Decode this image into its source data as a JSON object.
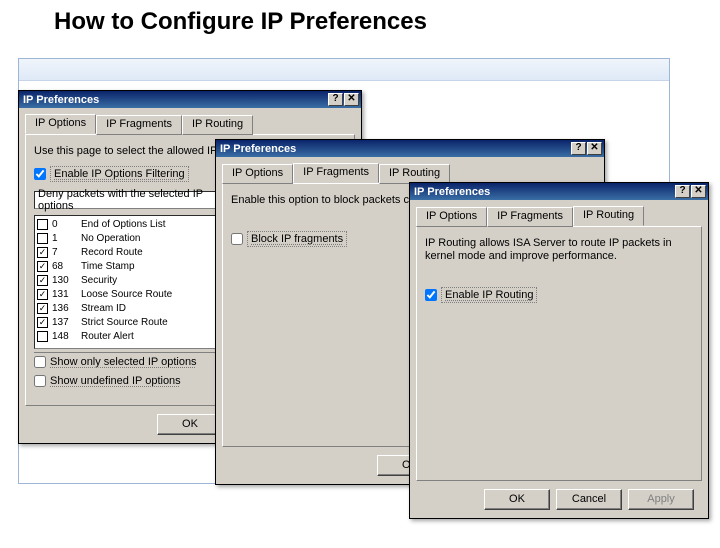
{
  "page_title": "How to Configure IP Preferences",
  "dialog_title": "IP Preferences",
  "sysbuttons": {
    "help": "?",
    "close": "✕"
  },
  "tabs": {
    "options": "IP Options",
    "fragments": "IP Fragments",
    "routing": "IP Routing"
  },
  "buttons": {
    "ok": "OK",
    "cancel": "Cancel",
    "apply": "Apply"
  },
  "dlg1": {
    "intro": "Use this page to select the allowed IP options.",
    "enable_label": "Enable IP Options Filtering",
    "combo_value": "Deny packets with the selected IP options",
    "show_only_selected": "Show only selected IP options",
    "show_undefined": "Show undefined IP options",
    "options": [
      {
        "code": "0",
        "desc": "End of Options List",
        "checked": false
      },
      {
        "code": "1",
        "desc": "No Operation",
        "checked": false
      },
      {
        "code": "7",
        "desc": "Record Route",
        "checked": true
      },
      {
        "code": "68",
        "desc": "Time Stamp",
        "checked": true
      },
      {
        "code": "130",
        "desc": "Security",
        "checked": true
      },
      {
        "code": "131",
        "desc": "Loose Source Route",
        "checked": true
      },
      {
        "code": "136",
        "desc": "Stream ID",
        "checked": true
      },
      {
        "code": "137",
        "desc": "Strict Source Route",
        "checked": true
      },
      {
        "code": "148",
        "desc": "Router Alert",
        "checked": false
      }
    ]
  },
  "dlg2": {
    "intro": "Enable this option to block packets containing IP fragments.",
    "block_fragments": "Block IP fragments"
  },
  "dlg3": {
    "intro": "IP Routing allows ISA Server to route IP packets in kernel mode and improve performance.",
    "enable_routing": "Enable IP Routing"
  }
}
